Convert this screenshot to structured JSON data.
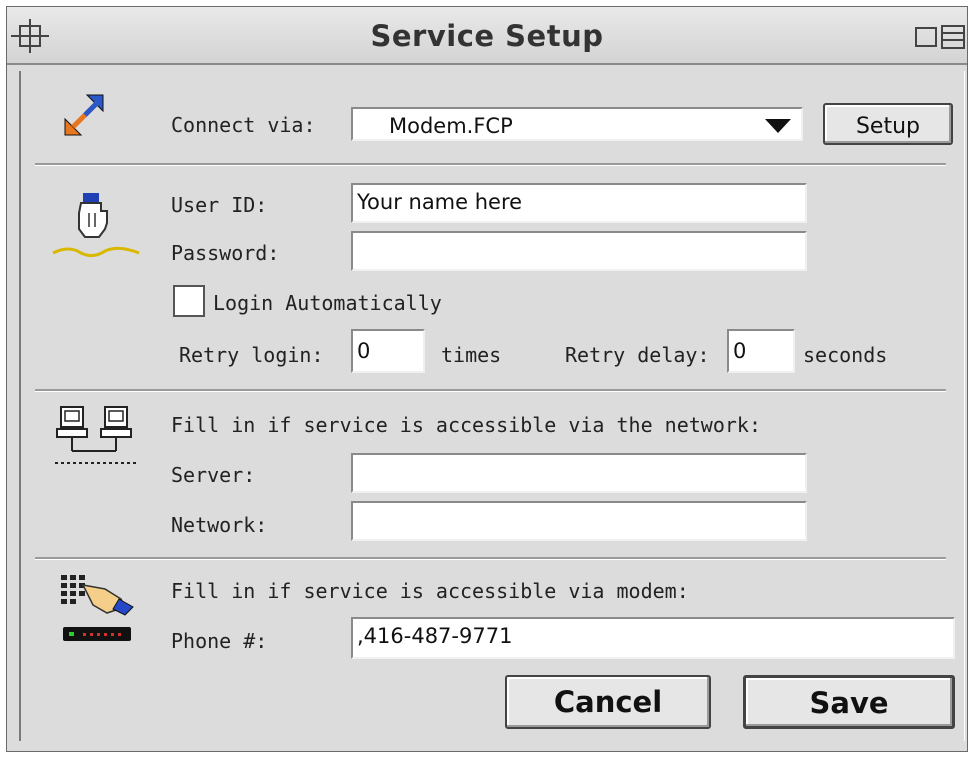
{
  "window": {
    "title": "Service Setup"
  },
  "connect": {
    "label": "Connect via:",
    "selected": "Modem.FCP",
    "setup_button": "Setup"
  },
  "login": {
    "user_id_label": "User ID:",
    "user_id_value": "Your name here",
    "password_label": "Password:",
    "password_value": "",
    "auto_login_label": "Login Automatically",
    "auto_login_checked": false,
    "retry_login_label": "Retry login:",
    "retry_login_value": "0",
    "times_label": "times",
    "retry_delay_label": "Retry delay:",
    "retry_delay_value": "0",
    "seconds_label": "seconds"
  },
  "network": {
    "note": "Fill in if service is accessible via the network:",
    "server_label": "Server:",
    "server_value": "",
    "network_label": "Network:",
    "network_value": ""
  },
  "modem": {
    "note": "Fill in if service is accessible via modem:",
    "phone_label": "Phone #:",
    "phone_value": ",416-487-9771"
  },
  "buttons": {
    "cancel": "Cancel",
    "save": "Save"
  },
  "icons": {
    "connect": "connection-arrows-icon",
    "login": "hand-pointer-icon",
    "network": "networked-computers-icon",
    "modem": "modem-keypad-icon"
  }
}
